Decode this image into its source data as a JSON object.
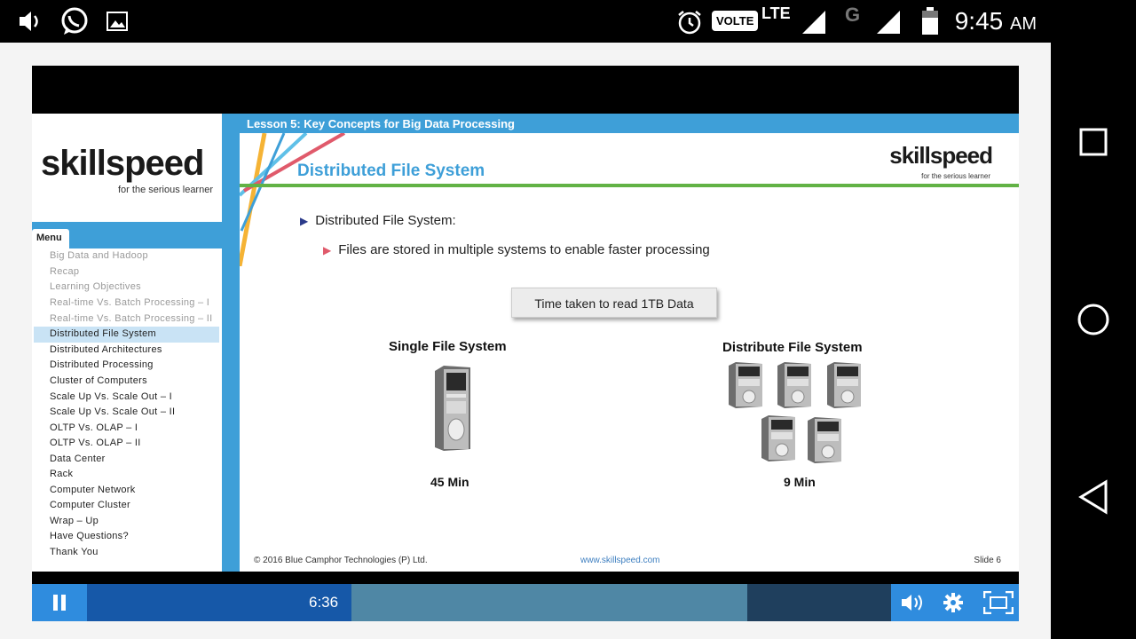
{
  "status_bar": {
    "network_label": "VOLTE",
    "lte_label": "LTE",
    "second_sim_label": "G",
    "time": "9:45",
    "ampm": "AM",
    "icons": [
      "volume-icon",
      "whatsapp-icon",
      "gallery-icon",
      "alarm-icon",
      "signal-icon",
      "battery-icon"
    ]
  },
  "left_panel": {
    "logo_text": "skillspeed",
    "logo_tagline": "for the serious learner",
    "menu_tab_label": "Menu",
    "menu_items": [
      {
        "label": "Big Data and Hadoop",
        "state": "visited"
      },
      {
        "label": "Recap",
        "state": "visited"
      },
      {
        "label": "Learning Objectives",
        "state": "visited"
      },
      {
        "label": "Real-time Vs. Batch Processing – I",
        "state": "visited"
      },
      {
        "label": "Real-time Vs. Batch Processing – II",
        "state": "visited"
      },
      {
        "label": "Distributed File System",
        "state": "current"
      },
      {
        "label": "Distributed Architectures",
        "state": "normal"
      },
      {
        "label": "Distributed Processing",
        "state": "normal"
      },
      {
        "label": "Cluster of Computers",
        "state": "normal"
      },
      {
        "label": "Scale Up Vs. Scale Out – I",
        "state": "normal"
      },
      {
        "label": "Scale Up Vs. Scale Out – II",
        "state": "normal"
      },
      {
        "label": "OLTP Vs. OLAP – I",
        "state": "normal"
      },
      {
        "label": "OLTP Vs. OLAP – II",
        "state": "normal"
      },
      {
        "label": "Data Center",
        "state": "normal"
      },
      {
        "label": "Rack",
        "state": "normal"
      },
      {
        "label": "Computer Network",
        "state": "normal"
      },
      {
        "label": "Computer Cluster",
        "state": "normal"
      },
      {
        "label": "Wrap – Up",
        "state": "normal"
      },
      {
        "label": "Have Questions?",
        "state": "normal"
      },
      {
        "label": "Thank You",
        "state": "normal"
      }
    ]
  },
  "slide": {
    "lesson_title": "Lesson 5: Key Concepts for Big Data Processing",
    "title": "Distributed File System",
    "logo_text": "skillspeed",
    "logo_tagline": "for the serious learner",
    "bullet_1": "Distributed File System:",
    "bullet_2": "Files are stored in multiple systems to enable faster processing",
    "box_label": "Time taken to read 1TB Data",
    "single": {
      "title": "Single File System",
      "value": "45 Min"
    },
    "distributed": {
      "title": "Distribute File System",
      "value": "9 Min"
    },
    "footer_copyright": "© 2016 Blue Camphor Technologies (P) Ltd.",
    "footer_url": "www.skillspeed.com",
    "footer_slide": "Slide 6"
  },
  "player_controls": {
    "current_time": "6:36",
    "played_fraction": 0.33,
    "buffered_fraction": 0.82
  },
  "colors": {
    "accent_blue": "#3e9fd8",
    "green_rule": "#62b245",
    "control_blue": "#2f8cde"
  }
}
